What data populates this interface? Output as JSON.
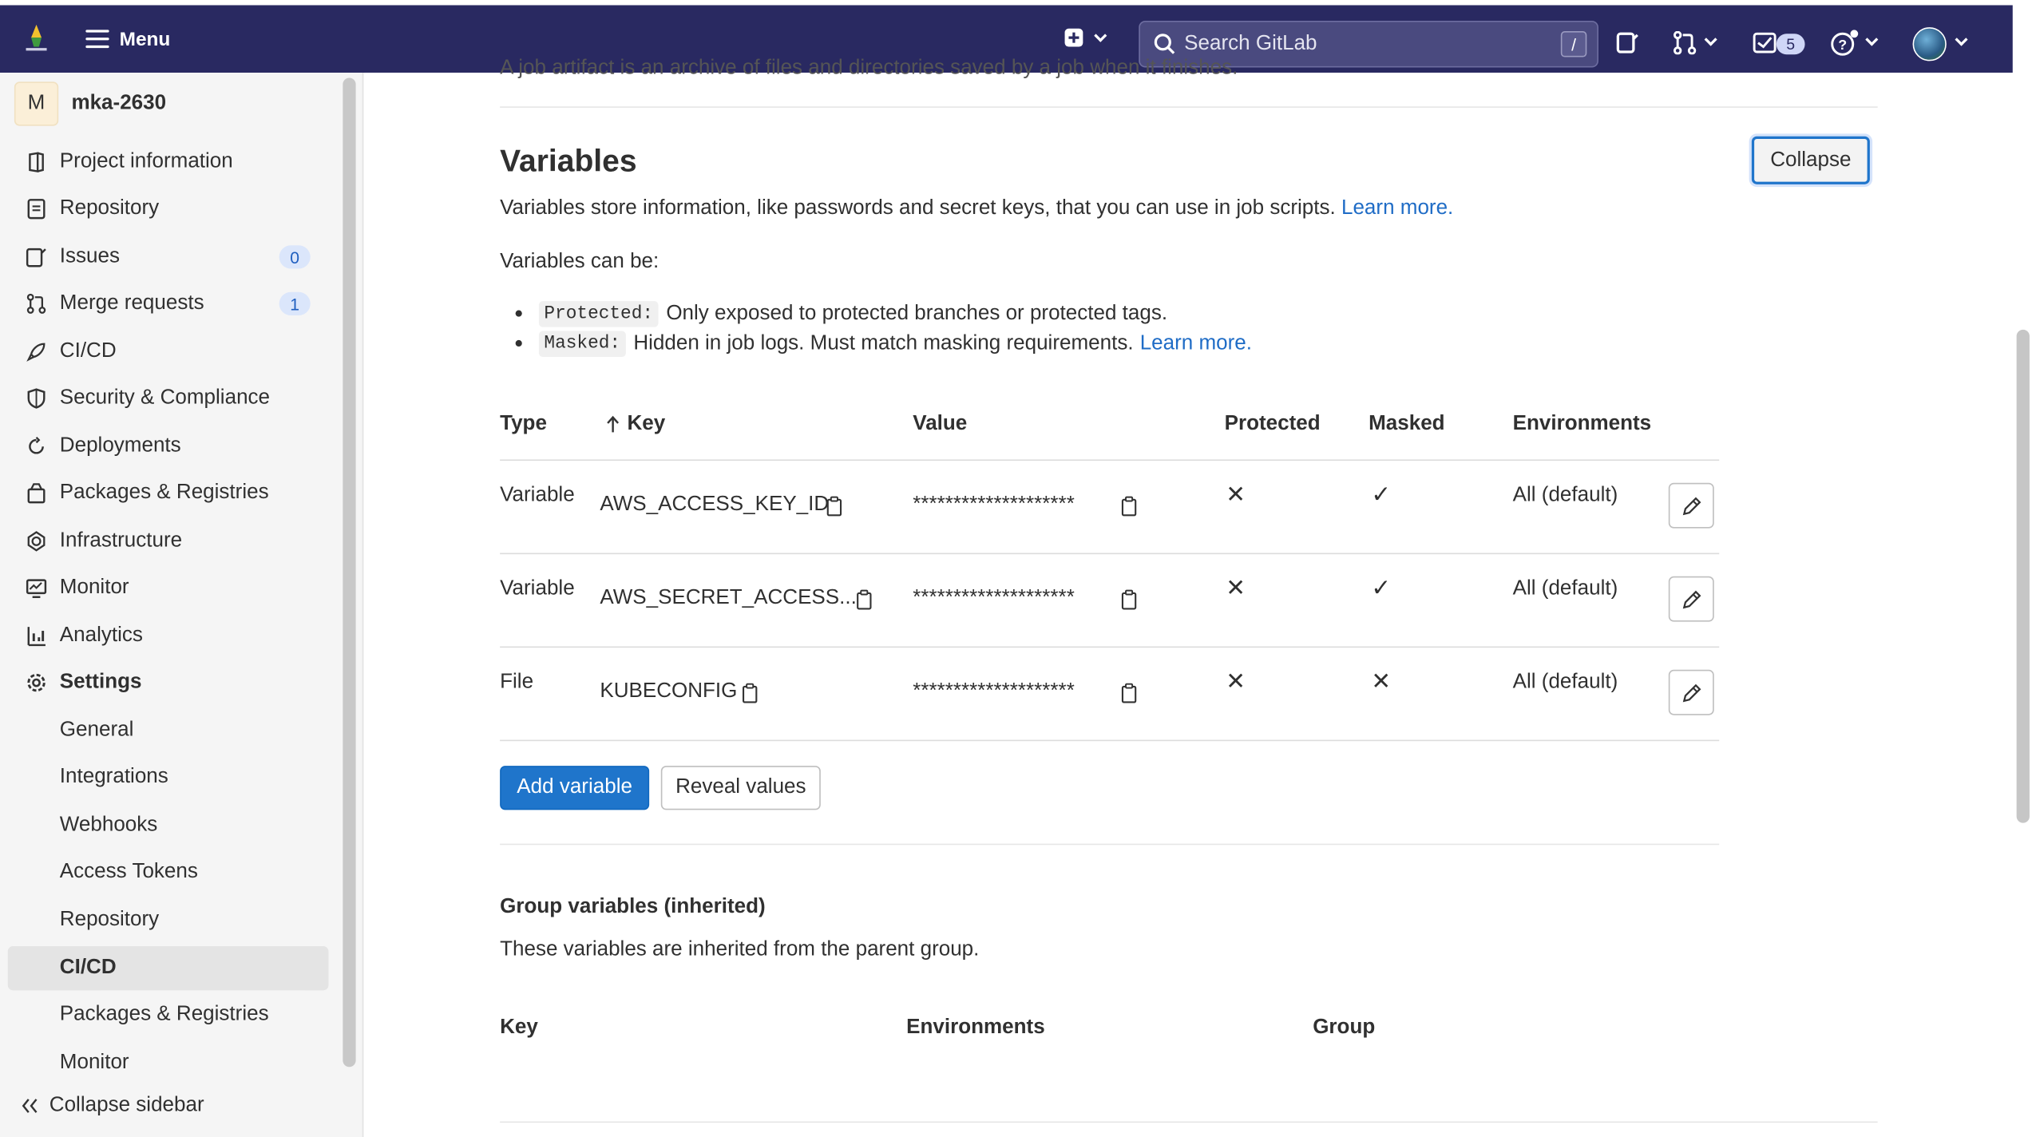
{
  "topbar": {
    "menu_label": "Menu",
    "search_placeholder": "Search GitLab",
    "search_shortcut": "/",
    "todo_count": "5"
  },
  "sidebar": {
    "project_initial": "M",
    "project_name": "mka-2630",
    "items": [
      {
        "label": "Project information",
        "icon": "info-icon"
      },
      {
        "label": "Repository",
        "icon": "doc-icon"
      },
      {
        "label": "Issues",
        "icon": "issues-icon",
        "badge": "0"
      },
      {
        "label": "Merge requests",
        "icon": "merge-request-icon",
        "badge": "1"
      },
      {
        "label": "CI/CD",
        "icon": "rocket-icon"
      },
      {
        "label": "Security & Compliance",
        "icon": "shield-icon"
      },
      {
        "label": "Deployments",
        "icon": "deployments-icon"
      },
      {
        "label": "Packages & Registries",
        "icon": "package-icon"
      },
      {
        "label": "Infrastructure",
        "icon": "cloud-icon"
      },
      {
        "label": "Monitor",
        "icon": "monitor-icon"
      },
      {
        "label": "Analytics",
        "icon": "chart-icon"
      },
      {
        "label": "Settings",
        "icon": "gear-icon"
      }
    ],
    "settings_sub": [
      "General",
      "Integrations",
      "Webhooks",
      "Access Tokens",
      "Repository",
      "CI/CD",
      "Packages & Registries",
      "Monitor"
    ],
    "active_sub": "CI/CD",
    "collapse_label": "Collapse sidebar"
  },
  "main": {
    "cut_text": "A job artifact is an archive of files and directories saved by a job when it finishes.",
    "title": "Variables",
    "collapse_label": "Collapse",
    "description": "Variables store information, like passwords and secret keys, that you can use in job scripts.",
    "learn_more": "Learn more.",
    "can_be": "Variables can be:",
    "bullets": [
      {
        "code": "Protected:",
        "text": "Only exposed to protected branches or protected tags.",
        "link": ""
      },
      {
        "code": "Masked:",
        "text": "Hidden in job logs. Must match masking requirements.",
        "link": "Learn more."
      }
    ],
    "table": {
      "headers": [
        "Type",
        "Key",
        "Value",
        "Protected",
        "Masked",
        "Environments"
      ],
      "rows": [
        {
          "type": "Variable",
          "key": "AWS_ACCESS_KEY_ID",
          "value": "********************",
          "protected": "✕",
          "masked": "✓",
          "env": "All (default)"
        },
        {
          "type": "Variable",
          "key": "AWS_SECRET_ACCESS...",
          "value": "********************",
          "protected": "✕",
          "masked": "✓",
          "env": "All (default)"
        },
        {
          "type": "File",
          "key": "KUBECONFIG",
          "value": "********************",
          "protected": "✕",
          "masked": "✕",
          "env": "All (default)"
        }
      ]
    },
    "add_variable": "Add variable",
    "reveal_values": "Reveal values",
    "group_title": "Group variables (inherited)",
    "group_desc": "These variables are inherited from the parent group.",
    "group_headers": [
      "Key",
      "Environments",
      "Group"
    ]
  }
}
